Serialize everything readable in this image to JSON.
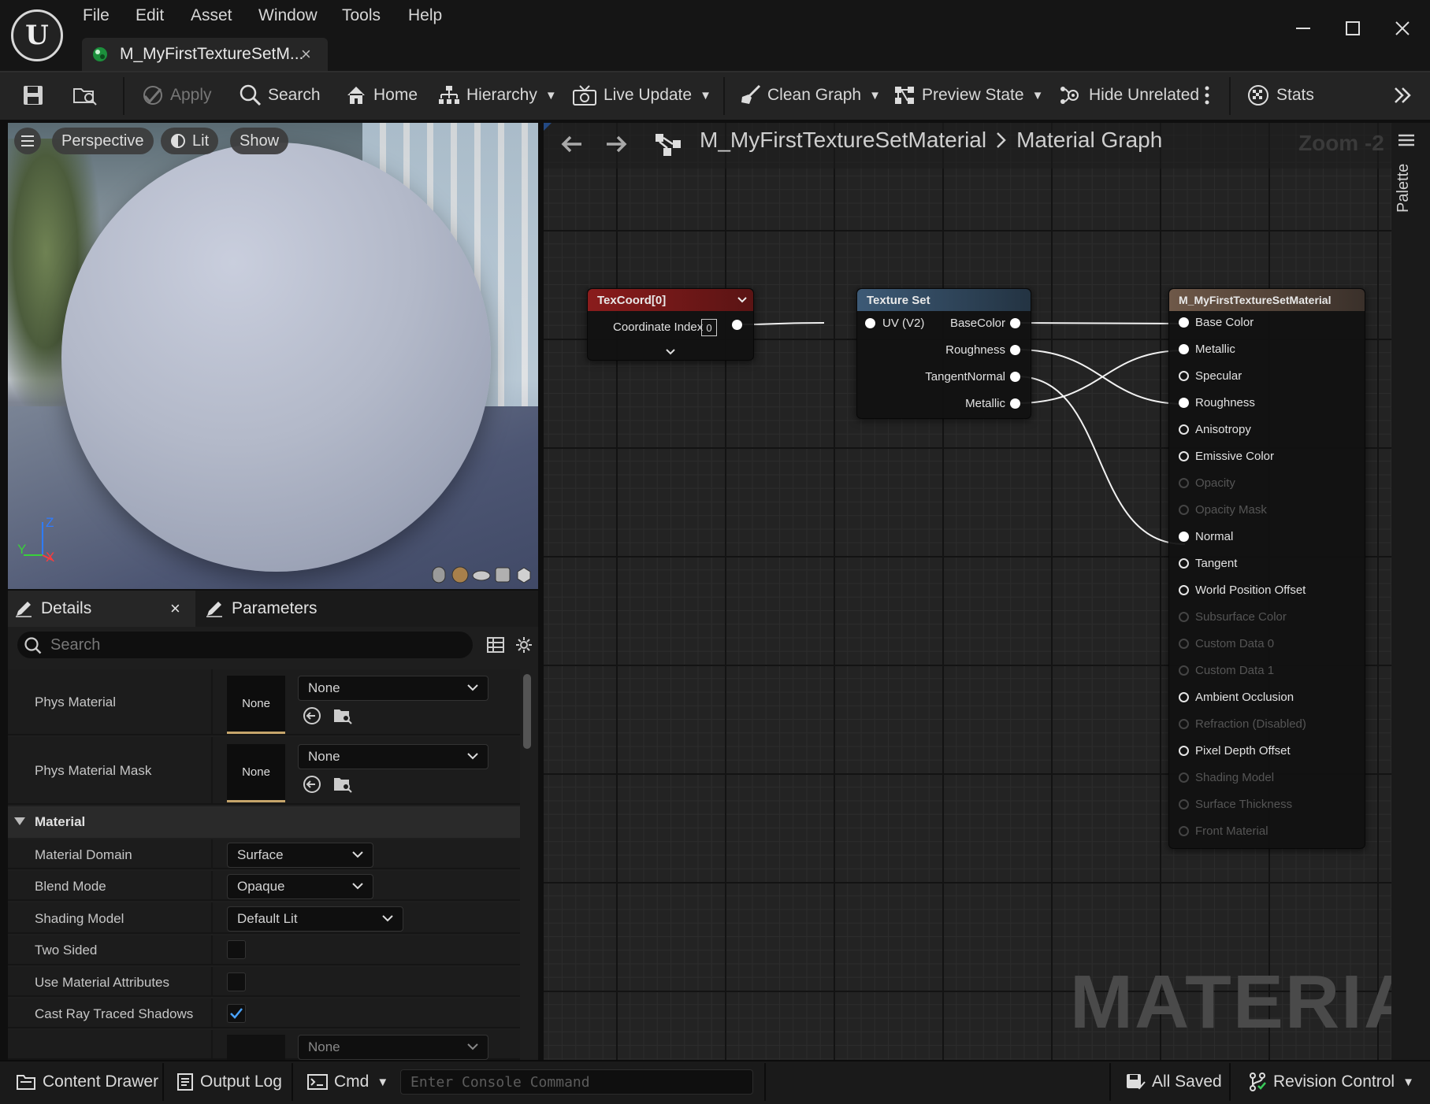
{
  "menu": [
    "File",
    "Edit",
    "Asset",
    "Window",
    "Tools",
    "Help"
  ],
  "tab": {
    "title": "M_MyFirstTextureSetM...",
    "close": "×"
  },
  "toolbar": {
    "apply": "Apply",
    "search": "Search",
    "home": "Home",
    "hierarchy": "Hierarchy",
    "live_update": "Live Update",
    "clean_graph": "Clean Graph",
    "preview_state": "Preview State",
    "hide_unrelated": "Hide Unrelated",
    "stats": "Stats"
  },
  "viewport": {
    "perspective": "Perspective",
    "lit": "Lit",
    "show": "Show",
    "axis": {
      "z": "Z",
      "y": "Y",
      "x": "X"
    }
  },
  "details": {
    "tab_details": "Details",
    "tab_parameters": "Parameters",
    "close": "×",
    "search_placeholder": "Search",
    "phys_material": {
      "label": "Phys Material",
      "thumb": "None",
      "value": "None"
    },
    "phys_material_mask": {
      "label": "Phys Material Mask",
      "thumb": "None",
      "value": "None"
    },
    "category": "Material",
    "props": [
      {
        "label": "Material Domain",
        "value": "Surface"
      },
      {
        "label": "Blend Mode",
        "value": "Opaque"
      },
      {
        "label": "Shading Model",
        "value": "Default Lit"
      },
      {
        "label": "Two Sided",
        "checked": false
      },
      {
        "label": "Use Material Attributes",
        "checked": false
      },
      {
        "label": "Cast Ray Traced Shadows",
        "checked": true
      }
    ],
    "next_value": "None"
  },
  "graph": {
    "breadcrumb_root": "M_MyFirstTextureSetMaterial",
    "breadcrumb_leaf": "Material Graph",
    "zoom": "Zoom -2",
    "watermark": "MATERIAL",
    "palette": "Palette",
    "texcoord": {
      "title": "TexCoord[0]",
      "pin": "Coordinate Index",
      "index": "0"
    },
    "texture_set": {
      "title": "Texture Set",
      "input": "UV (V2)",
      "outputs": [
        "BaseColor",
        "Roughness",
        "TangentNormal",
        "Metallic"
      ]
    },
    "material_node": {
      "title": "M_MyFirstTextureSetMaterial",
      "inputs": [
        {
          "label": "Base Color",
          "state": "connected"
        },
        {
          "label": "Metallic",
          "state": "connected"
        },
        {
          "label": "Specular",
          "state": "open"
        },
        {
          "label": "Roughness",
          "state": "connected"
        },
        {
          "label": "Anisotropy",
          "state": "open"
        },
        {
          "label": "Emissive Color",
          "state": "open"
        },
        {
          "label": "Opacity",
          "state": "disabled"
        },
        {
          "label": "Opacity Mask",
          "state": "disabled"
        },
        {
          "label": "Normal",
          "state": "connected"
        },
        {
          "label": "Tangent",
          "state": "open"
        },
        {
          "label": "World Position Offset",
          "state": "open"
        },
        {
          "label": "Subsurface Color",
          "state": "disabled"
        },
        {
          "label": "Custom Data 0",
          "state": "disabled"
        },
        {
          "label": "Custom Data 1",
          "state": "disabled"
        },
        {
          "label": "Ambient Occlusion",
          "state": "open"
        },
        {
          "label": "Refraction (Disabled)",
          "state": "disabled"
        },
        {
          "label": "Pixel Depth Offset",
          "state": "open"
        },
        {
          "label": "Shading Model",
          "state": "disabled"
        },
        {
          "label": "Surface Thickness",
          "state": "disabled"
        },
        {
          "label": "Front Material",
          "state": "disabled"
        }
      ]
    }
  },
  "statusbar": {
    "content_drawer": "Content Drawer",
    "output_log": "Output Log",
    "cmd": "Cmd",
    "console_placeholder": "Enter Console Command",
    "all_saved": "All Saved",
    "revision_control": "Revision Control"
  },
  "colors": {
    "texcoord_header": "#8a1c1c",
    "texture_set_header": "#34495e",
    "material_header": "#6e5848",
    "accent_blue": "#4aa3ff",
    "watermark": "#4a4a4a"
  }
}
